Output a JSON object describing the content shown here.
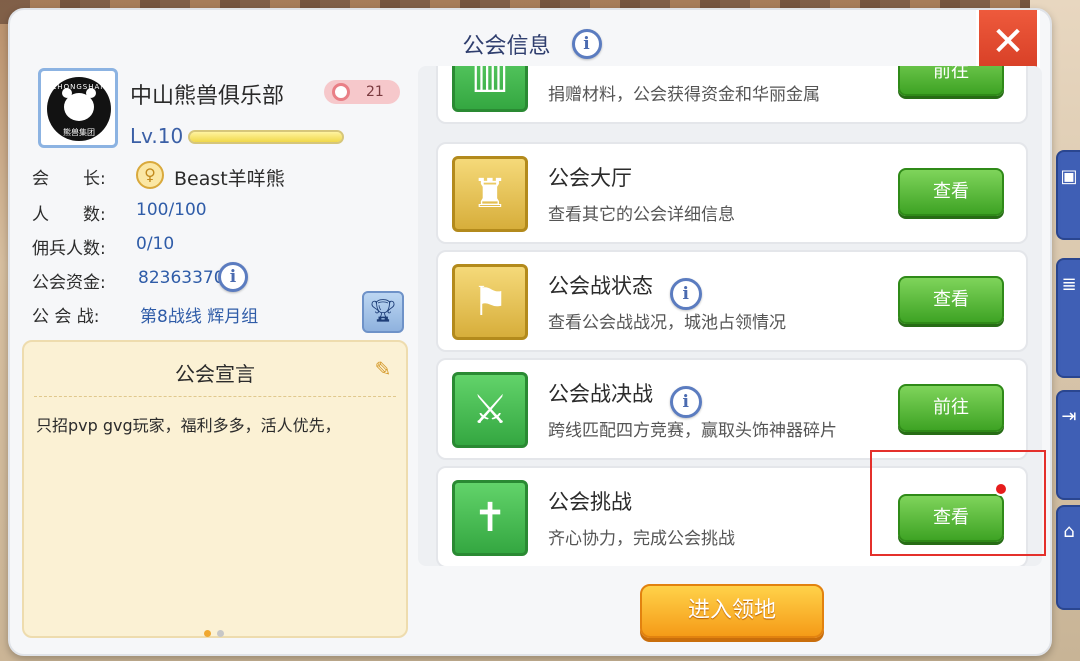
{
  "window": {
    "title": "公会信息",
    "close_label": "✕"
  },
  "guild": {
    "logo_text_top": "ZHONGSHAN",
    "logo_text_bottom": "熊兽集团",
    "name": "中山熊兽俱乐部",
    "badge_value": "21",
    "level": "Lv.10",
    "exp_progress": 1.0
  },
  "stats": [
    {
      "label": "会　　长:",
      "value": "Beast羊咩熊",
      "icon": "female-symbol-icon"
    },
    {
      "label": "人　　数:",
      "value": "100/100"
    },
    {
      "label": "佣兵人数:",
      "value": "0/10"
    },
    {
      "label": "公会资金:",
      "value": "82363370"
    },
    {
      "label": "公 会 战:",
      "value": "第8战线  辉月组"
    }
  ],
  "manifesto": {
    "title": "公会宣言",
    "text": "只招pvp gvg玩家，福利多多，活人优先，",
    "pages": 2,
    "current_page": 1
  },
  "features": [
    {
      "name": "",
      "desc": "捐赠材料，公会获得资金和华丽金属",
      "button": "前往",
      "icon": "donation-book-icon",
      "icon_color": "green",
      "has_info": false,
      "notify": false
    },
    {
      "name": "公会大厅",
      "desc": "查看其它的公会详细信息",
      "button": "查看",
      "icon": "castle-hall-icon",
      "icon_color": "gold",
      "has_info": false,
      "notify": false
    },
    {
      "name": "公会战状态",
      "desc": "查看公会战战况，城池占领情况",
      "button": "查看",
      "icon": "flag-fortress-icon",
      "icon_color": "gold",
      "has_info": true,
      "notify": false
    },
    {
      "name": "公会战决战",
      "desc": "跨线匹配四方竞赛，赢取头饰神器碎片",
      "button": "前往",
      "icon": "crossed-swords-fortress-icon",
      "icon_color": "green",
      "has_info": true,
      "notify": false
    },
    {
      "name": "公会挑战",
      "desc": "齐心协力，完成公会挑战",
      "button": "查看",
      "icon": "challenge-shrine-icon",
      "icon_color": "green",
      "has_info": false,
      "notify": true
    }
  ],
  "actions": {
    "enter_territory": "进入领地"
  },
  "colors": {
    "accent_green": "#3ea324",
    "accent_orange": "#f59b18",
    "close_red": "#d33a22",
    "title_blue": "#2f3e6e"
  }
}
